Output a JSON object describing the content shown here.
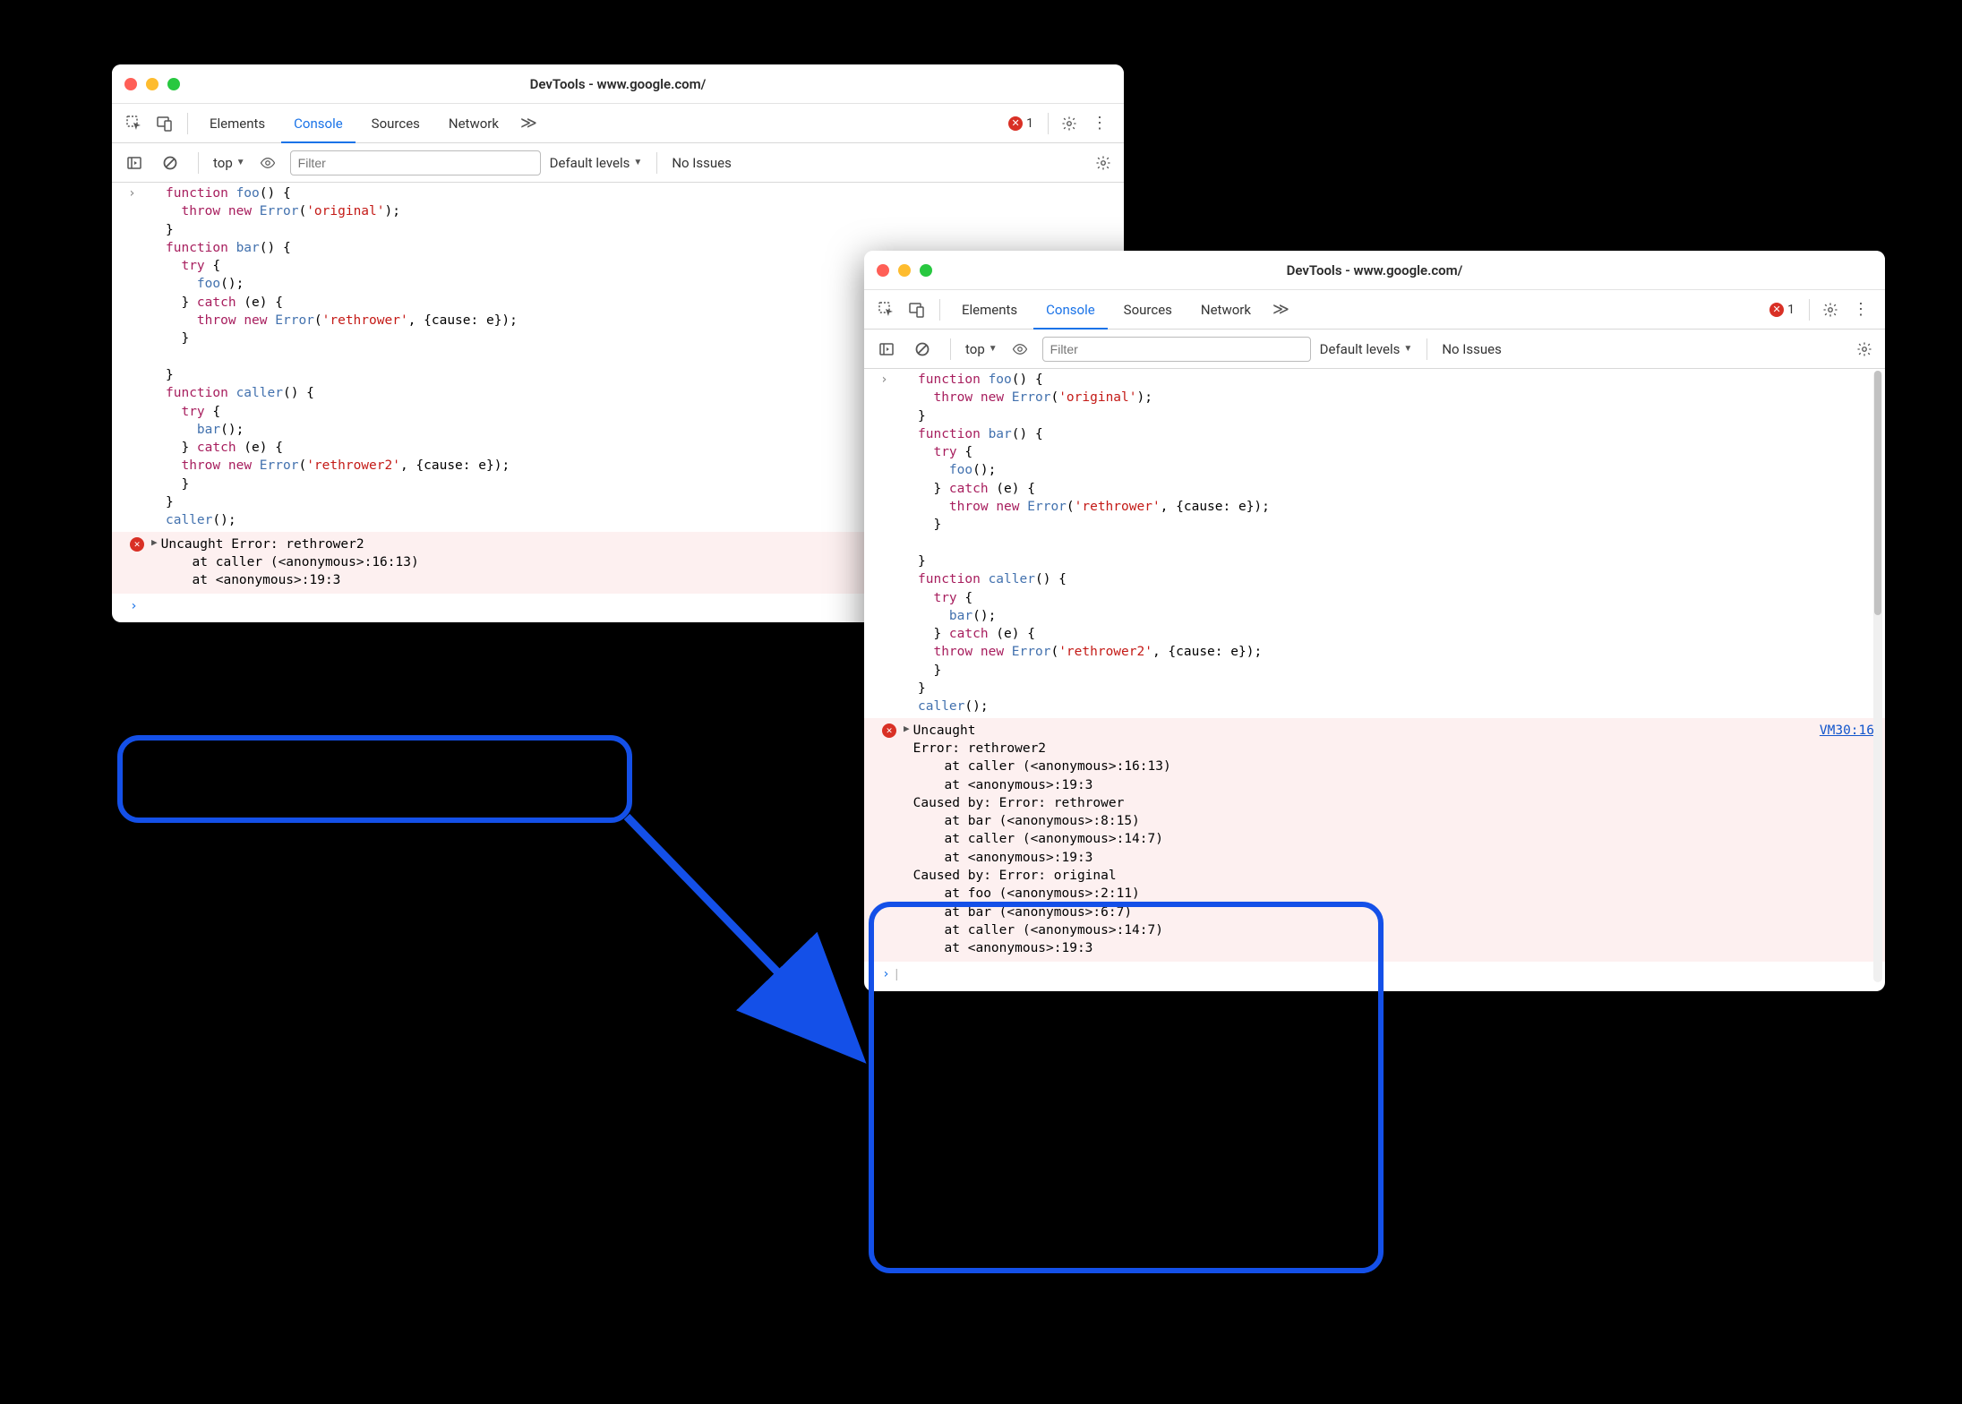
{
  "window": {
    "title": "DevTools - www.google.com/"
  },
  "tabs": {
    "elements": "Elements",
    "console": "Console",
    "sources": "Sources",
    "network": "Network"
  },
  "error_count": "1",
  "sub": {
    "context": "top",
    "filter_placeholder": "Filter",
    "levels": "Default levels",
    "noissues": "No Issues"
  },
  "code": "function foo() {\n  throw new Error('original');\n}\nfunction bar() {\n  try {\n    foo();\n  } catch (e) {\n    throw new Error('rethrower', {cause: e});\n  }\n\n}\nfunction caller() {\n  try {\n    bar();\n  } catch (e) {\n  throw new Error('rethrower2', {cause: e});\n  }\n}\ncaller();",
  "error1": {
    "head": "Uncaught Error: rethrower2",
    "line1": "    at caller (<anonymous>:16:13)",
    "line2": "    at <anonymous>:19:3"
  },
  "error2": {
    "head": "Uncaught",
    "link": "VM30:16",
    "lines": [
      "Error: rethrower2",
      "    at caller (<anonymous>:16:13)",
      "    at <anonymous>:19:3",
      "Caused by: Error: rethrower",
      "    at bar (<anonymous>:8:15)",
      "    at caller (<anonymous>:14:7)",
      "    at <anonymous>:19:3",
      "Caused by: Error: original",
      "    at foo (<anonymous>:2:11)",
      "    at bar (<anonymous>:6:7)",
      "    at caller (<anonymous>:14:7)",
      "    at <anonymous>:19:3"
    ]
  }
}
